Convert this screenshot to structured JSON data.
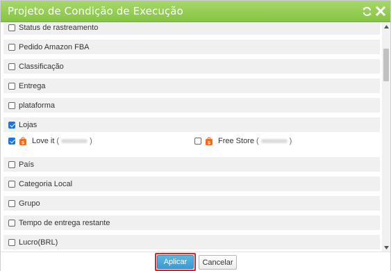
{
  "window": {
    "title": "Projeto de Condição de Execução",
    "icons": [
      "refresh-icon",
      "close-icon"
    ]
  },
  "colors": {
    "titlebar": "#86c443",
    "row_background": "#f0f0f0",
    "checkbox_checked": "#1a73e8",
    "apply_button": "#3b9ad0",
    "highlight_border": "#e02020",
    "shop_icon": "#f26b1d"
  },
  "rows": [
    {
      "label": "Status de rastreamento",
      "checked": false
    },
    {
      "label": "Pedido Amazon FBA",
      "checked": false
    },
    {
      "label": "Classificação",
      "checked": false
    },
    {
      "label": "Entrega",
      "checked": false
    },
    {
      "label": "plataforma",
      "checked": false
    },
    {
      "label": "Lojas",
      "checked": true
    },
    {
      "label": "País",
      "checked": false
    },
    {
      "label": "Categoria Local",
      "checked": false
    },
    {
      "label": "Grupo",
      "checked": false
    },
    {
      "label": "Tempo de entrega restante",
      "checked": false
    },
    {
      "label": "Lucro(BRL)",
      "checked": false
    }
  ],
  "stores": [
    {
      "name": "Love it",
      "checked": true,
      "open_paren": "(",
      "close_paren": ")",
      "icon": "shopee-icon"
    },
    {
      "name": "Free Store",
      "checked": false,
      "open_paren": "(",
      "close_paren": ")",
      "icon": "shopee-icon"
    }
  ],
  "footer": {
    "apply_label": "Aplicar",
    "cancel_label": "Cancelar"
  }
}
